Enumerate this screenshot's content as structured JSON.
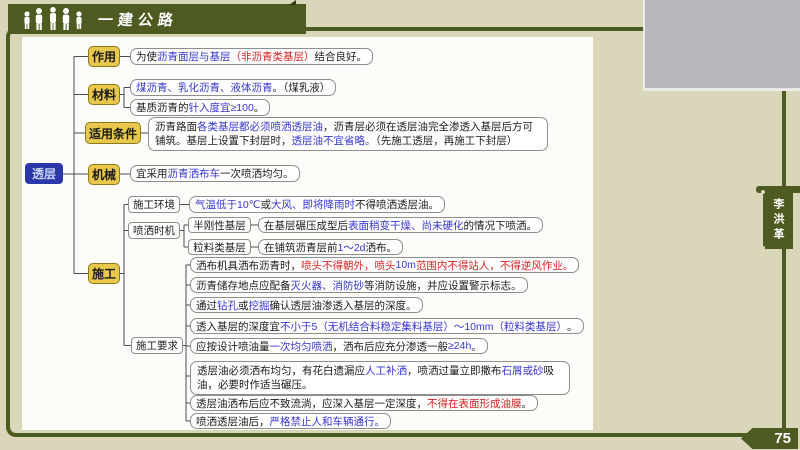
{
  "header": {
    "logo_text": "一建公路"
  },
  "side": {
    "instructor": "李洪革"
  },
  "footer": {
    "page": "75"
  },
  "colors": {
    "background_tan": "#d9d6ba",
    "accent_green": "#4d5a20",
    "root_blue": "#2b38a8",
    "node_yellow": "#e7c84d",
    "highlight_blue": "#3535cf",
    "highlight_red": "#d42222",
    "camera_gray": "#b9b7bb"
  },
  "mindmap": {
    "root": "透层",
    "b_zuoyong": "作用",
    "b_cailiao": "材料",
    "b_shiyong": "适用条件",
    "b_jixie": "机械",
    "b_shigong": "施工",
    "l_huanjing": "施工环境",
    "l_shiji": "喷洒时机",
    "l_bangang": "半刚性基层",
    "l_liliao": "粒料类基层",
    "l_yaoqiu": "施工要求",
    "leaves": {
      "zuoyong": [
        {
          "t": "为使",
          "c": "k"
        },
        {
          "t": "沥青面层与基层",
          "c": "b"
        },
        {
          "t": "（非沥青类基层）",
          "c": "r"
        },
        {
          "t": "结合良好。",
          "c": "k"
        }
      ],
      "cailiao1": [
        {
          "t": "煤沥青、乳化沥青、液体沥青",
          "c": "b"
        },
        {
          "t": "。（煤乳液）",
          "c": "k"
        }
      ],
      "cailiao2": [
        {
          "t": "基质沥青的",
          "c": "k"
        },
        {
          "t": "针入度宜≥100",
          "c": "b"
        },
        {
          "t": "。",
          "c": "k"
        }
      ],
      "shiyong": [
        {
          "t": "沥青路面",
          "c": "k"
        },
        {
          "t": "各类基层都必须喷洒透层油",
          "c": "b"
        },
        {
          "t": "，沥青层必须在透层油完全渗透入基层后方可铺筑。基层上设置下封层时，",
          "c": "k"
        },
        {
          "t": "透层油不宜省略。",
          "c": "b"
        },
        {
          "t": "（先施工透层，再施工下封层）",
          "c": "k"
        }
      ],
      "jixie": [
        {
          "t": "宜采用",
          "c": "k"
        },
        {
          "t": "沥青洒布车",
          "c": "b"
        },
        {
          "t": "一次喷洒均匀。",
          "c": "k"
        }
      ],
      "huanjing": [
        {
          "t": "气温低于10℃",
          "c": "b"
        },
        {
          "t": "或",
          "c": "k"
        },
        {
          "t": "大风、即将降雨时",
          "c": "b"
        },
        {
          "t": "不得喷洒透层油。",
          "c": "k"
        }
      ],
      "bangang": [
        {
          "t": "在基层碾压成型后",
          "c": "k"
        },
        {
          "t": "表面稍变干燥、尚未硬化",
          "c": "b"
        },
        {
          "t": "的情况下喷洒。",
          "c": "k"
        }
      ],
      "liliao": [
        {
          "t": "在铺筑沥青层前",
          "c": "k"
        },
        {
          "t": "1～2d",
          "c": "b"
        },
        {
          "t": "洒布。",
          "c": "k"
        }
      ],
      "item1": [
        {
          "t": "洒布机具洒布沥青时，",
          "c": "k"
        },
        {
          "t": "喷头不得朝外，喷头",
          "c": "r"
        },
        {
          "t": "10m",
          "c": "b"
        },
        {
          "t": "范围内不得站人，不得逆风作业。",
          "c": "r"
        }
      ],
      "item2": [
        {
          "t": "沥青储存地点应配备",
          "c": "k"
        },
        {
          "t": "灭火器、消防砂",
          "c": "b"
        },
        {
          "t": "等消防设施，并应设置警示标志。",
          "c": "k"
        }
      ],
      "item3": [
        {
          "t": "通过",
          "c": "k"
        },
        {
          "t": "钻孔",
          "c": "b"
        },
        {
          "t": "或",
          "c": "k"
        },
        {
          "t": "挖掘",
          "c": "b"
        },
        {
          "t": "确认透层油渗透入基层的深度。",
          "c": "k"
        }
      ],
      "item4": [
        {
          "t": "透入基层的深度宜",
          "c": "k"
        },
        {
          "t": "不小于5（无机结合料稳定集料基层）～10mm（粒料类基层）",
          "c": "b"
        },
        {
          "t": "。",
          "c": "k"
        }
      ],
      "item5": [
        {
          "t": "应按设计喷油量",
          "c": "k"
        },
        {
          "t": "一次均匀喷洒",
          "c": "b"
        },
        {
          "t": "，洒布后应充分渗透一般",
          "c": "k"
        },
        {
          "t": "≥24h",
          "c": "b"
        },
        {
          "t": "。",
          "c": "k"
        }
      ],
      "item6": [
        {
          "t": "透层油必须洒布均匀，有花白遗漏应",
          "c": "k"
        },
        {
          "t": "人工补洒",
          "c": "b"
        },
        {
          "t": "，喷洒过量立即撒布",
          "c": "k"
        },
        {
          "t": "石屑或砂",
          "c": "b"
        },
        {
          "t": "吸油，必要时作适当碾压。",
          "c": "k"
        }
      ],
      "item7": [
        {
          "t": "透层油洒布后应不致流淌，应深入基层一定深度，",
          "c": "k"
        },
        {
          "t": "不得在表面形成油膜",
          "c": "r"
        },
        {
          "t": "。",
          "c": "k"
        }
      ],
      "item8": [
        {
          "t": "喷洒透层油后，",
          "c": "k"
        },
        {
          "t": "严格禁止人和车辆通行。",
          "c": "b"
        }
      ]
    }
  }
}
